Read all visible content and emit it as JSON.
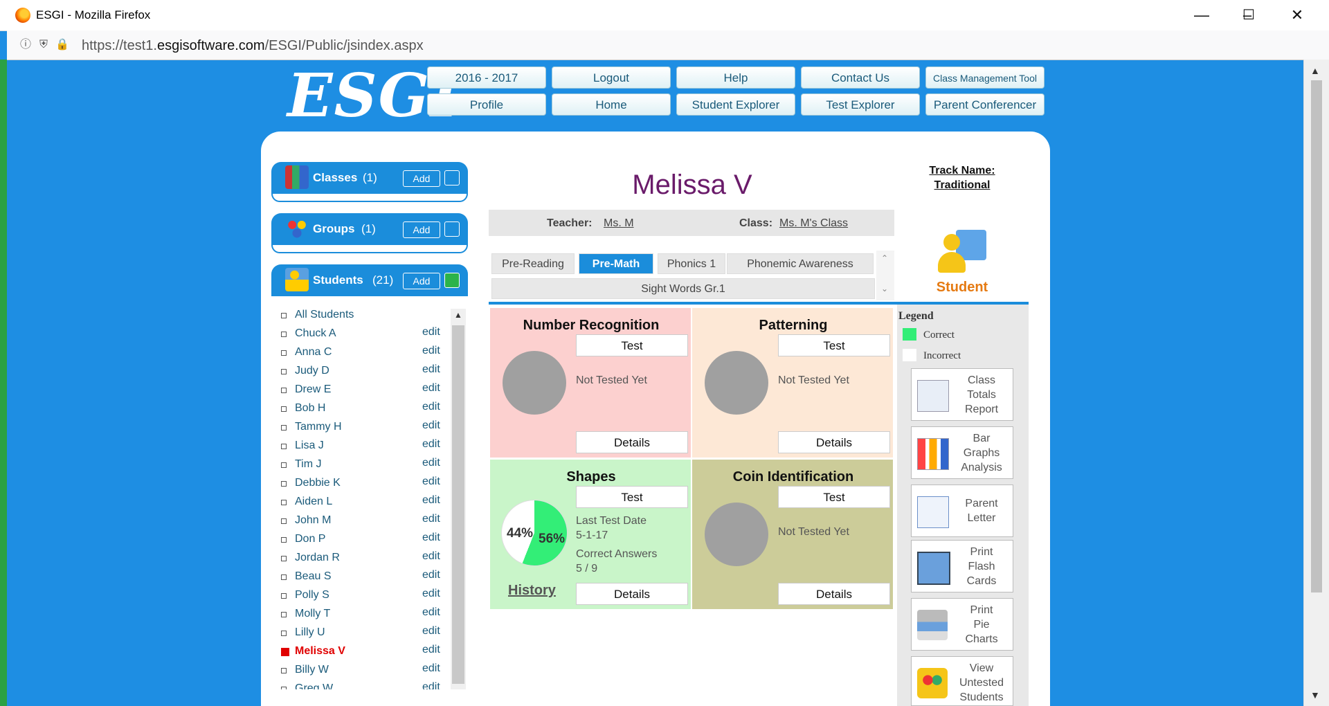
{
  "window": {
    "title": "ESGI - Mozilla Firefox",
    "url_prefix": "https://test1.",
    "url_domain": "esgisoftware.com",
    "url_path": "/ESGI/Public/jsindex.aspx"
  },
  "logo": "ESGI",
  "nav": {
    "row1": [
      "2016 - 2017",
      "Logout",
      "Help",
      "Contact Us",
      "Class Management Tool"
    ],
    "row2": [
      "Profile",
      "Home",
      "Student Explorer",
      "Test Explorer",
      "Parent Conferencer"
    ]
  },
  "sidebar": {
    "classes": {
      "label": "Classes",
      "count": "(1)",
      "add": "Add"
    },
    "groups": {
      "label": "Groups",
      "count": "(1)",
      "add": "Add"
    },
    "students": {
      "label": "Students",
      "count": "(21)",
      "add": "Add"
    },
    "all_students": "All Students",
    "edit_label": "edit",
    "students_list": [
      "Chuck A",
      "Anna C",
      "Judy D",
      "Drew E",
      "Bob H",
      "Tammy H",
      "Lisa J",
      "Tim J",
      "Debbie K",
      "Aiden L",
      "John M",
      "Don P",
      "Jordan R",
      "Beau S",
      "Polly S",
      "Molly T",
      "Lilly U",
      "Melissa V",
      "Billy W",
      "Greg W"
    ],
    "selected": "Melissa V"
  },
  "student": {
    "name": "Melissa V",
    "teacher_label": "Teacher:",
    "teacher": "Ms. M",
    "class_label": "Class:",
    "class": "Ms. M's Class"
  },
  "tabs": [
    {
      "label": "Pre-Reading",
      "active": false
    },
    {
      "label": "Pre-Math",
      "active": true
    },
    {
      "label": "Phonics 1",
      "active": false
    },
    {
      "label": "Phonemic Awareness",
      "active": false
    },
    {
      "label": "Sight Words Gr.1",
      "active": false
    }
  ],
  "cards": [
    {
      "title": "Number Recognition",
      "test": "Test",
      "status": "Not Tested Yet",
      "details": "Details",
      "color": "#fcd0cf"
    },
    {
      "title": "Patterning",
      "test": "Test",
      "status": "Not Tested Yet",
      "details": "Details",
      "color": "#fde8d6"
    },
    {
      "title": "Shapes",
      "test": "Test",
      "last_test_label": "Last Test Date",
      "last_test_date": "5-1-17",
      "correct_label": "Correct Answers",
      "correct_value": "5 / 9",
      "pct_incorrect": "44%",
      "pct_correct": "56%",
      "correct_fraction": 0.56,
      "history": "History",
      "details": "Details",
      "color": "#c9f5c9"
    },
    {
      "title": "Coin Identification",
      "test": "Test",
      "status": "Not Tested Yet",
      "details": "Details",
      "color": "#cccc99"
    }
  ],
  "right": {
    "track_label": "Track Name:",
    "track_name": "Traditional",
    "student_label": "Student",
    "legend_title": "Legend",
    "legend_correct": "Correct",
    "legend_incorrect": "Incorrect",
    "colors": {
      "correct": "#33ee77",
      "incorrect": "#ffffff"
    },
    "buttons": [
      {
        "lines": [
          "Class",
          "Totals",
          "Report"
        ]
      },
      {
        "lines": [
          "Bar",
          "Graphs",
          "Analysis"
        ]
      },
      {
        "lines": [
          "Parent",
          "Letter"
        ]
      },
      {
        "lines": [
          "Print",
          "Flash",
          "Cards"
        ]
      },
      {
        "lines": [
          "Print",
          "Pie",
          "Charts"
        ]
      },
      {
        "lines": [
          "View",
          "Untested",
          "Students"
        ]
      }
    ]
  }
}
